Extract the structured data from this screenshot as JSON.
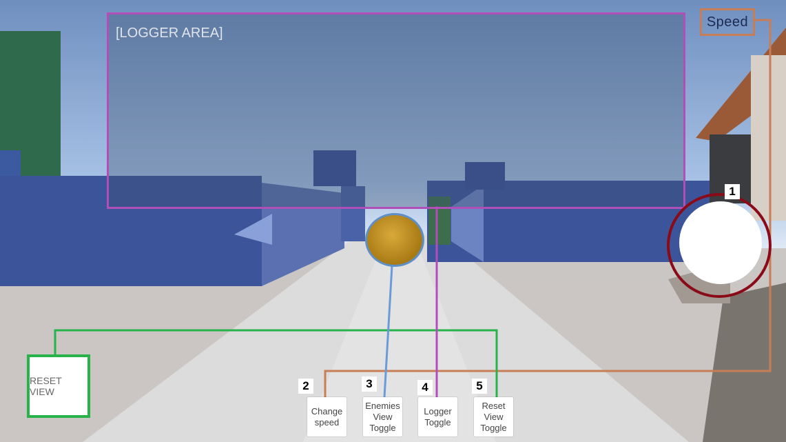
{
  "logger": {
    "label": "[LOGGER AREA]"
  },
  "speed": {
    "label": "Speed"
  },
  "reset_view": {
    "label": "RESET VIEW"
  },
  "joystick": {
    "number": "1"
  },
  "buttons": [
    {
      "number": "2",
      "label": "Change\nspeed"
    },
    {
      "number": "3",
      "label": "Enemies\nView\nToggle"
    },
    {
      "number": "4",
      "label": "Logger\nToggle"
    },
    {
      "number": "5",
      "label": "Reset\nView\nToggle"
    }
  ],
  "colors": {
    "logger_outline": "#b04fb8",
    "speed_outline": "#c77e57",
    "reset_outline": "#27b24a",
    "enemies_line": "#6a9bd8",
    "joystick_ring": "#8a0a18"
  }
}
